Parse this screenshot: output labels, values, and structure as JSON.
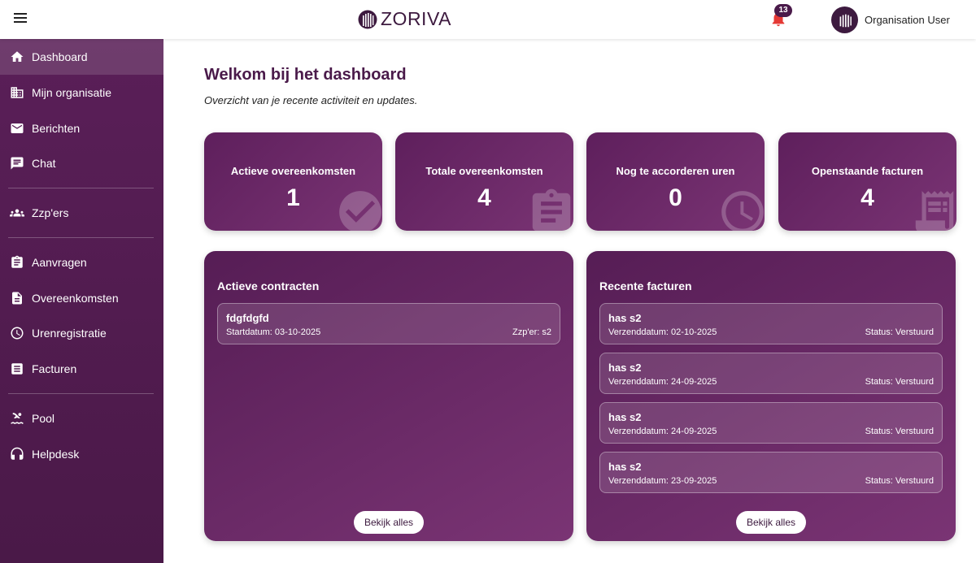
{
  "header": {
    "brand": "ZORIVA",
    "notification_count": "13",
    "user_name": "Organisation User"
  },
  "sidebar": {
    "items": [
      {
        "label": "Dashboard",
        "icon": "home-icon"
      },
      {
        "label": "Mijn organisatie",
        "icon": "building-icon"
      },
      {
        "label": "Berichten",
        "icon": "mail-icon"
      },
      {
        "label": "Chat",
        "icon": "chat-icon"
      },
      {
        "label": "Zzp'ers",
        "icon": "people-icon"
      },
      {
        "label": "Aanvragen",
        "icon": "clipboard-icon"
      },
      {
        "label": "Overeenkomsten",
        "icon": "document-icon"
      },
      {
        "label": "Urenregistratie",
        "icon": "clock-icon"
      },
      {
        "label": "Facturen",
        "icon": "list-icon"
      },
      {
        "label": "Pool",
        "icon": "pool-icon"
      },
      {
        "label": "Helpdesk",
        "icon": "headset-icon"
      }
    ]
  },
  "main": {
    "title": "Welkom bij het dashboard",
    "subtitle": "Overzicht van je recente activiteit en updates."
  },
  "stats": [
    {
      "label": "Actieve overeenkomsten",
      "value": "1",
      "icon": "check-circle-icon"
    },
    {
      "label": "Totale overeenkomsten",
      "value": "4",
      "icon": "clipboard-icon"
    },
    {
      "label": "Nog te accorderen uren",
      "value": "0",
      "icon": "clock-icon"
    },
    {
      "label": "Openstaande facturen",
      "value": "4",
      "icon": "receipt-icon"
    }
  ],
  "contracts": {
    "title": "Actieve contracten",
    "items": [
      {
        "name": "fdgfdgfd",
        "start": "Startdatum: 03-10-2025",
        "zzp": "Zzp'er: s2"
      }
    ],
    "view_all": "Bekijk alles"
  },
  "invoices": {
    "title": "Recente facturen",
    "items": [
      {
        "name": "has s2",
        "date": "Verzenddatum: 02-10-2025",
        "status": "Status: Verstuurd"
      },
      {
        "name": "has s2",
        "date": "Verzenddatum: 24-09-2025",
        "status": "Status: Verstuurd"
      },
      {
        "name": "has s2",
        "date": "Verzenddatum: 24-09-2025",
        "status": "Status: Verstuurd"
      },
      {
        "name": "has s2",
        "date": "Verzenddatum: 23-09-2025",
        "status": "Status: Verstuurd"
      }
    ],
    "view_all": "Bekijk alles"
  },
  "colors": {
    "brand_purple": "#4a1a4a",
    "sidebar": "#5a1f58",
    "bell": "#e53935"
  }
}
